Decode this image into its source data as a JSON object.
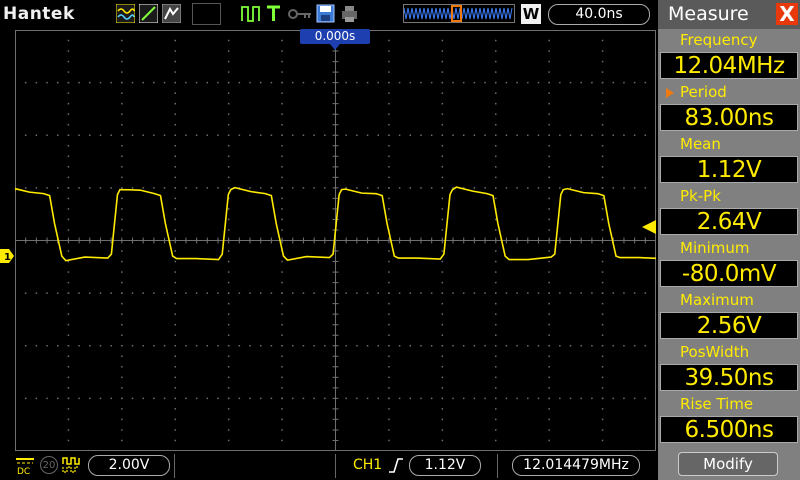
{
  "brand": "Hantek",
  "toolbar": {
    "icons": [
      "waveform-mode-icon",
      "line-draw-icon",
      "persistence-icon",
      "run-stop-icon",
      "trigger-icon",
      "key-lock-icon",
      "save-icon",
      "print-icon"
    ]
  },
  "timebase": "40.0ns",
  "memory_window_label": "W",
  "trigger_position": "0.000s",
  "channel_marker": "1",
  "bottom": {
    "coupling_label": "DC",
    "bandwidth_label": "20",
    "volt_div": "2.00V",
    "channel_label": "CH1",
    "trigger_level": "1.12V",
    "frequency": "12.014479MHz"
  },
  "panel": {
    "title": "Measure",
    "close_label": "X",
    "measurements": [
      {
        "label": "Frequency",
        "value": "12.04MHz",
        "selected": false
      },
      {
        "label": "Period",
        "value": "83.00ns",
        "selected": true
      },
      {
        "label": "Mean",
        "value": "1.12V",
        "selected": false
      },
      {
        "label": "Pk-Pk",
        "value": "2.64V",
        "selected": false
      },
      {
        "label": "Minimum",
        "value": "-80.0mV",
        "selected": false
      },
      {
        "label": "Maximum",
        "value": "2.56V",
        "selected": false
      },
      {
        "label": "PosWidth",
        "value": "39.50ns",
        "selected": false
      },
      {
        "label": "Rise Time",
        "value": "6.500ns",
        "selected": false
      }
    ],
    "modify_label": "Modify"
  },
  "colors": {
    "trace": "#ffeb00",
    "grid": "#6e6e6e",
    "panel_bg": "#808080",
    "accent": "#f07a10",
    "close": "#e8390d",
    "trigger_flag": "#1e3fb0"
  },
  "waveform": {
    "timebase_per_div": "40.0ns",
    "volts_per_div": "2.00V",
    "period_ns": 83.0,
    "high_v": 2.56,
    "low_v": -0.08,
    "pos_width_ns": 39.5,
    "rise_time_ns": 6.5
  }
}
